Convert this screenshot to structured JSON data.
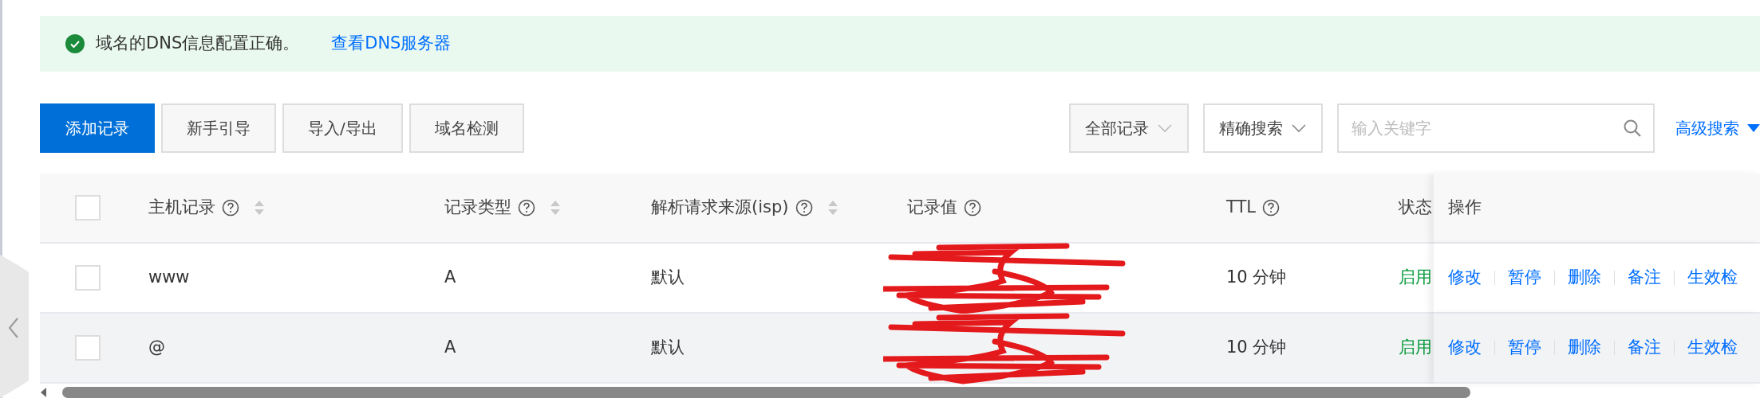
{
  "alert": {
    "kind": "success",
    "message": "域名的DNS信息配置正确。",
    "link": "查看DNS服务器"
  },
  "toolbar": {
    "buttons": [
      {
        "label": "添加记录",
        "kind": "primary"
      },
      {
        "label": "新手引导",
        "kind": "default"
      },
      {
        "label": "导入/导出",
        "kind": "default"
      },
      {
        "label": "域名检测",
        "kind": "default"
      }
    ],
    "filters": [
      {
        "label": "全部记录",
        "kind": "select"
      },
      {
        "label": "精确搜索",
        "kind": "outline"
      }
    ],
    "search": {
      "placeholder": "输入关键字"
    },
    "advanced_search": "高级搜索"
  },
  "table": {
    "select_all": {
      "checked": false
    },
    "columns": [
      {
        "label": "主机记录",
        "help": true,
        "sortable": true
      },
      {
        "label": "记录类型",
        "help": true,
        "sortable": true
      },
      {
        "label": "解析请求来源(isp)",
        "help": true,
        "sortable": true
      },
      {
        "label": "记录值",
        "help": true,
        "sortable": false
      },
      {
        "label": "TTL",
        "help": true,
        "sortable": false
      },
      {
        "label": "状态",
        "help": false,
        "sortable": false
      },
      {
        "label": "操作",
        "help": false,
        "sortable": false
      }
    ],
    "rows": [
      {
        "checked": false,
        "hovered": false,
        "host": "www",
        "type": "A",
        "source": "默认",
        "value_redacted": true,
        "ttl": "10 分钟",
        "status": "启用",
        "actions": [
          "修改",
          "暂停",
          "删除",
          "备注",
          "生效检"
        ]
      },
      {
        "checked": false,
        "hovered": true,
        "host": "@",
        "type": "A",
        "source": "默认",
        "value_redacted": true,
        "ttl": "10 分钟",
        "status": "启用",
        "actions": [
          "修改",
          "暂停",
          "删除",
          "备注",
          "生效检"
        ]
      }
    ]
  }
}
